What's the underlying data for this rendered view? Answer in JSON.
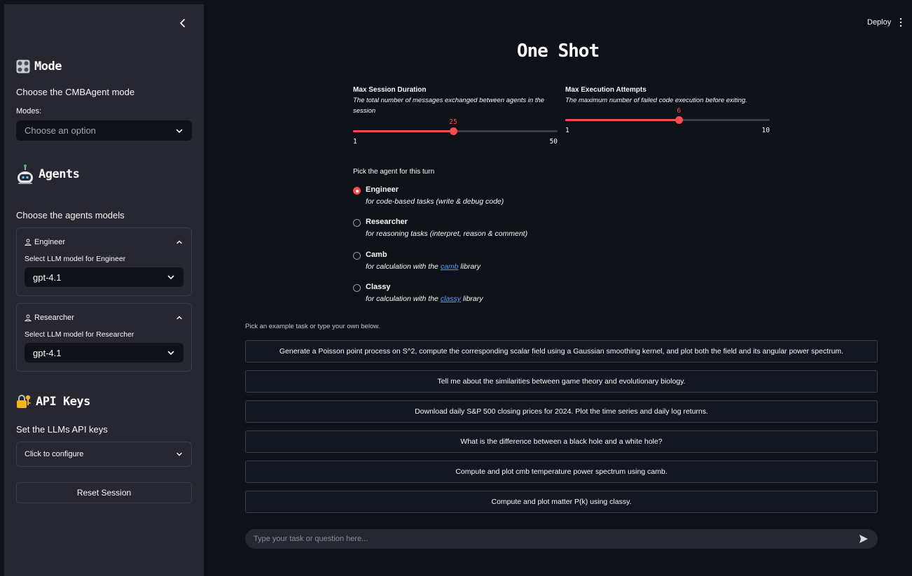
{
  "sidebar": {
    "mode": {
      "title": "Mode",
      "subtitle": "Choose the CMBAgent mode",
      "select_label": "Modes:",
      "select_placeholder": "Choose an option"
    },
    "agents": {
      "title": "Agents",
      "subtitle": "Choose the agents models",
      "expanders": [
        {
          "title": "Engineer",
          "select_label": "Select LLM model for Engineer",
          "value": "gpt-4.1"
        },
        {
          "title": "Researcher",
          "select_label": "Select LLM model for Researcher",
          "value": "gpt-4.1"
        }
      ]
    },
    "api_keys": {
      "title": "API Keys",
      "subtitle": "Set the LLMs API keys",
      "expander_label": "Click to configure"
    },
    "reset_label": "Reset Session"
  },
  "header": {
    "deploy_label": "Deploy"
  },
  "main": {
    "title": "One Shot",
    "sliders": [
      {
        "title": "Max Session Duration",
        "description": "The total number of messages exchanged between agents in the session",
        "value": 25,
        "min": 1,
        "max": 50
      },
      {
        "title": "Max Execution Attempts",
        "description": "The maximum number of failed code execution before exiting.",
        "value": 6,
        "min": 1,
        "max": 10
      }
    ],
    "radio_label": "Pick the agent for this turn",
    "radio_options": [
      {
        "name": "Engineer",
        "desc": "for code-based tasks (write & debug code)",
        "selected": true
      },
      {
        "name": "Researcher",
        "desc": "for reasoning tasks (interpret, reason & comment)",
        "selected": false
      },
      {
        "name": "Camb",
        "desc_before": "for calculation with the",
        "link": "camb",
        "desc_after": "library",
        "selected": false
      },
      {
        "name": "Classy",
        "desc_before": "for calculation with the",
        "link": "classy",
        "desc_after": "library",
        "selected": false
      }
    ],
    "examples_hint": "Pick an example task or type your own below.",
    "examples": [
      "Generate a Poisson point process on S^2, compute the corresponding scalar field using a Gaussian smoothing kernel, and plot both the field and its angular power spectrum.",
      "Tell me about the similarities between game theory and evolutionary biology.",
      "Download daily S&P 500 closing prices for 2024. Plot the time series and daily log returns.",
      "What is the difference between a black hole and a white hole?",
      "Compute and plot cmb temperature power spectrum using camb.",
      "Compute and plot matter P(k) using classy."
    ],
    "chat_placeholder": "Type your task or question here..."
  },
  "colors": {
    "accent": "#ff4b4b",
    "sidebar_bg": "#262730",
    "main_bg": "#0e1117",
    "link": "#4b9eff"
  }
}
